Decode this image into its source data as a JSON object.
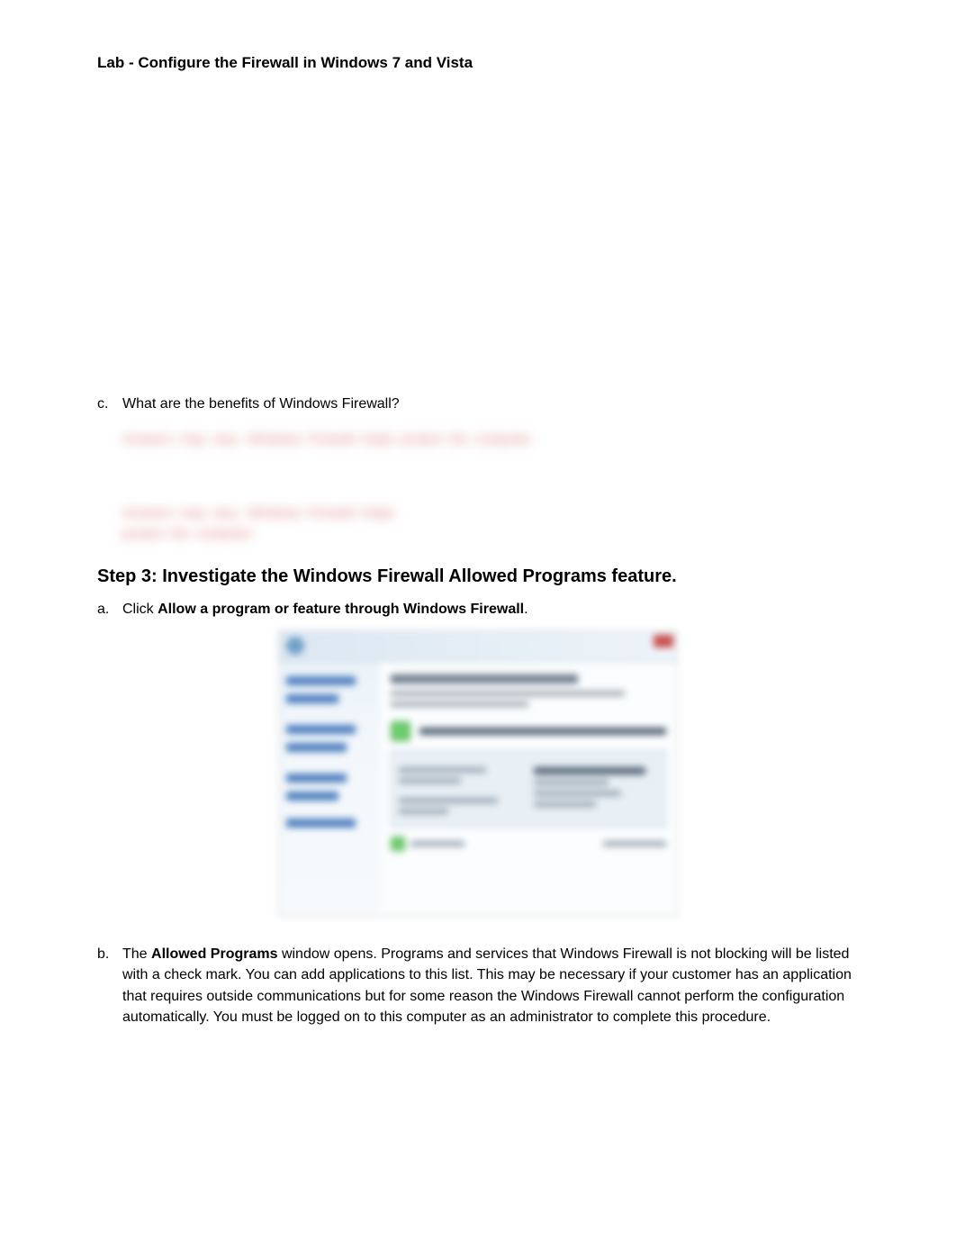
{
  "header": {
    "title": "Lab - Configure the Firewall in Windows 7 and Vista"
  },
  "item_c": {
    "marker": "c.",
    "text": "What are the benefits of Windows Firewall?",
    "answer_placeholder": "Answers may vary. Windows Firewall helps protect the computer."
  },
  "step3": {
    "heading": "Step 3: Investigate the Windows Firewall Allowed Programs feature.",
    "item_a": {
      "marker": "a.",
      "prefix": "Click ",
      "bold_text": "Allow a program or feature through Windows Firewall",
      "suffix": "."
    },
    "item_b": {
      "marker": "b.",
      "prefix": "The ",
      "bold_text": "Allowed Programs",
      "rest": " window opens. Programs and services that Windows Firewall is not blocking will be listed with a check mark. You can add applications to this list. This may be necessary if your customer has an application that requires outside communications but for some reason the Windows Firewall cannot perform the configuration automatically. You must be logged on to this computer as an administrator to complete this procedure."
    }
  },
  "screenshot": {
    "alt": "Windows Firewall control panel window (blurred)"
  }
}
